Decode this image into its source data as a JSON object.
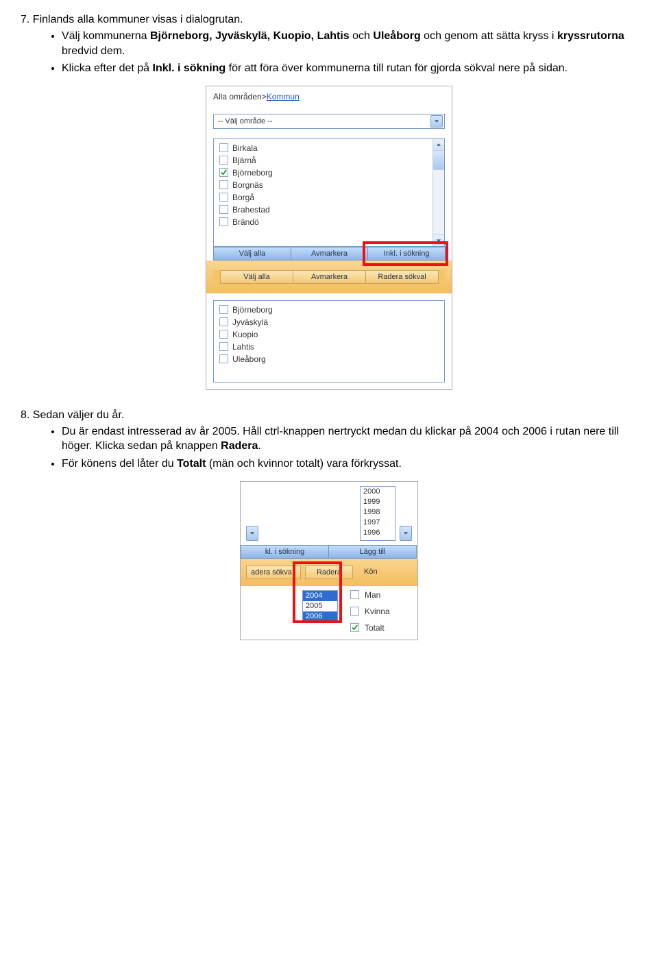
{
  "step7": {
    "title": "7. Finlands alla kommuner visas i dialogrutan.",
    "bullets": [
      {
        "pre": "Välj kommunerna ",
        "bold1": "Björneborg, Jyväskylä, Kuopio, Lahtis ",
        "mid1": "och ",
        "bold2": "Uleåborg",
        "mid2": " och genom att sätta kryss i ",
        "bold3": "kryssrutorna",
        "post": " bredvid dem."
      },
      {
        "pre": "Klicka efter det på ",
        "bold1": "Inkl. i sökning",
        "post": " för att föra över kommunerna till rutan för gjorda sökval nere på sidan."
      }
    ]
  },
  "panel1": {
    "breadcrumb_pre": "Alla områden>",
    "breadcrumb_link": "Kommun",
    "dropdown": "-- Välj område --",
    "items": [
      {
        "label": "Birkala",
        "checked": false
      },
      {
        "label": "Bjärnå",
        "checked": false
      },
      {
        "label": "Björneborg",
        "checked": true
      },
      {
        "label": "Borgnäs",
        "checked": false
      },
      {
        "label": "Borgå",
        "checked": false
      },
      {
        "label": "Brahestad",
        "checked": false
      },
      {
        "label": "Brändö",
        "checked": false
      }
    ],
    "blue_buttons": [
      "Välj alla",
      "Avmarkera",
      "Inkl. i sökning"
    ],
    "amber_buttons": [
      "Välj alla",
      "Avmarkera",
      "Radera sökval"
    ],
    "selected_items": [
      "Björneborg",
      "Jyväskylä",
      "Kuopio",
      "Lahtis",
      "Uleåborg"
    ]
  },
  "step8": {
    "title": "8. Sedan väljer du år.",
    "bullets": [
      {
        "pre": "Du är endast intresserad av år 2005. Håll ctrl-knappen nertryckt medan du klickar på 2004 och 2006 i rutan nere till höger. Klicka sedan på knappen ",
        "bold1": "Radera",
        "post": "."
      },
      {
        "pre": "För könens del låter du ",
        "bold1": "Totalt",
        "post": " (män och kvinnor totalt) vara förkryssat."
      }
    ]
  },
  "panel2": {
    "years_top": [
      "2000",
      "1999",
      "1998",
      "1997",
      "1996"
    ],
    "blue_buttons": [
      "kl. i sökning",
      "Lägg till"
    ],
    "amber_items": [
      "adera sökva",
      "Radera",
      "Kön"
    ],
    "years_sel": [
      {
        "y": "2004",
        "sel": true
      },
      {
        "y": "2005",
        "sel": false
      },
      {
        "y": "2006",
        "sel": true
      }
    ],
    "genders": [
      {
        "label": "Man",
        "checked": false
      },
      {
        "label": "Kvinna",
        "checked": false
      },
      {
        "label": "Totalt",
        "checked": true
      }
    ]
  }
}
